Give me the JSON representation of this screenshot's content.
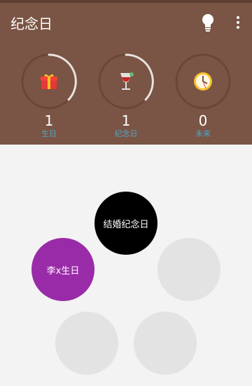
{
  "app": {
    "title": "纪念日"
  },
  "header": {
    "stats": [
      {
        "count": "1",
        "label": "生日",
        "icon": "gift-icon"
      },
      {
        "count": "1",
        "label": "纪念日",
        "icon": "wine-glass-icon"
      },
      {
        "count": "0",
        "label": "未来",
        "icon": "clock-icon"
      }
    ]
  },
  "bubbles": [
    {
      "label": "结婚纪念日",
      "color": "#000000"
    },
    {
      "label": "李x生日",
      "color": "#9a2ba8"
    },
    {
      "label": "",
      "color": "#e3e3e3"
    },
    {
      "label": "",
      "color": "#e3e3e3"
    },
    {
      "label": "",
      "color": "#e3e3e3"
    }
  ],
  "colors": {
    "header_bg": "#7a5444",
    "label": "#4fa6c7",
    "ring_track": "#6b4638",
    "ring_progress": "#e9e2de"
  }
}
